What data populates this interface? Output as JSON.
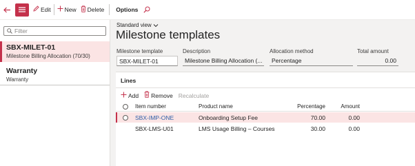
{
  "actions": {
    "edit": "Edit",
    "new": "New",
    "delete": "Delete",
    "options": "Options"
  },
  "filter": {
    "placeholder": "Filter"
  },
  "list": [
    {
      "title": "SBX-MILET-01",
      "subtitle": "Milestone Billing Allocation (70/30)"
    },
    {
      "title": "Warranty",
      "subtitle": "Warranty"
    }
  ],
  "view": {
    "label": "Standard view"
  },
  "page": {
    "title": "Milestone templates"
  },
  "header_fields": {
    "template_label": "Milestone template",
    "template_value": "SBX-MILET-01",
    "description_label": "Description",
    "description_value": "Milestone Billing Allocation (...",
    "allocation_label": "Allocation method",
    "allocation_value": "Percentage",
    "total_label": "Total amount",
    "total_value": "0.00"
  },
  "lines": {
    "title": "Lines",
    "add": "Add",
    "remove": "Remove",
    "recalculate": "Recalculate",
    "columns": [
      "Item number",
      "Product name",
      "Percentage",
      "Amount"
    ],
    "rows": [
      [
        "SBX-IMP-ONE",
        "Onboarding Setup Fee",
        "70.00",
        "0.00"
      ],
      [
        "SBX-LMS-U01",
        "LMS Usage Billing – Courses",
        "30.00",
        "0.00"
      ]
    ]
  },
  "colors": {
    "accent": "#c4314b",
    "selected_bg": "#fbe4e4",
    "link": "#2f5fa7"
  }
}
